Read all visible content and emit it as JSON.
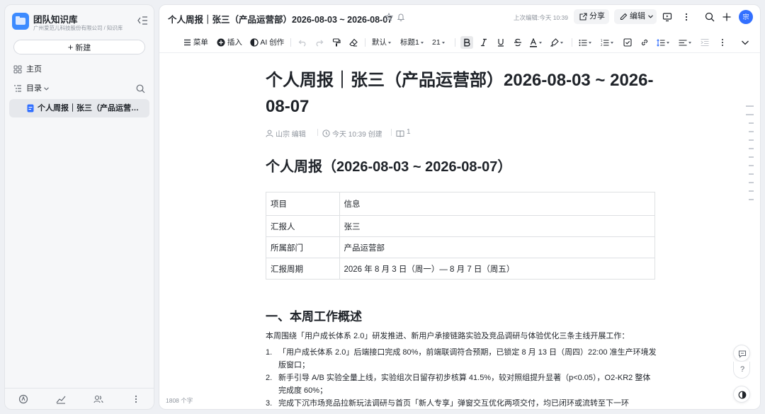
{
  "sidebar": {
    "kb_title": "团队知识库",
    "kb_subtitle": "广州爱范儿科技股份有限公司 / 知识库",
    "new_button": "新建",
    "home": "主页",
    "toc": "目录",
    "doc_item": "个人周报｜张三（产品运营部）2026-08-03 ~ 2026-08-07"
  },
  "topbar": {
    "title": "个人周报｜张三（产品运营部）2026-08-03 ~ 2026-08-07",
    "last_edit": "上次编辑:今天 10:39",
    "share": "分享",
    "edit": "编辑",
    "avatar": "宗"
  },
  "toolbar": {
    "menu": "菜单",
    "insert": "插入",
    "ai": "AI 创作",
    "font": "默认",
    "heading": "标题1",
    "size": "21"
  },
  "doc": {
    "title": "个人周报｜张三（产品运营部）2026-08-03 ~ 2026-08-07",
    "author": "山宗 编辑",
    "created": "今天 10:39 创建",
    "views": "1",
    "h2": "个人周报（2026-08-03 ~ 2026-08-07）",
    "table": [
      [
        "项目",
        "信息"
      ],
      [
        "汇报人",
        "张三"
      ],
      [
        "所属部门",
        "产品运营部"
      ],
      [
        "汇报周期",
        "2026 年 8 月 3 日（周一）— 8 月 7 日（周五）"
      ]
    ],
    "h3": "一、本周工作概述",
    "intro": "本周围绕「用户成长体系 2.0」研发推进、新用户承接链路实验及竞品调研与体验优化三条主线开展工作：",
    "items": [
      {
        "num": "1.",
        "text": "「用户成长体系 2.0」后端接口完成 80%，前端联调符合预期，已锁定 8 月 13 日（周四）22:00 准生产环境发版窗口；"
      },
      {
        "num": "2.",
        "text": "新手引导 A/B 实验全量上线，实验组次日留存初步核算 41.5%，较对照组提升显著（p<0.05），O2-KR2 整体完成度 60%；"
      },
      {
        "num": "3.",
        "text": "完成下沉市场竞品拉新玩法调研与首页「新人专享」弹窗交互优化两项交付，均已闭环或流转至下一环"
      }
    ]
  },
  "footer": {
    "word_count": "1808 个字"
  }
}
